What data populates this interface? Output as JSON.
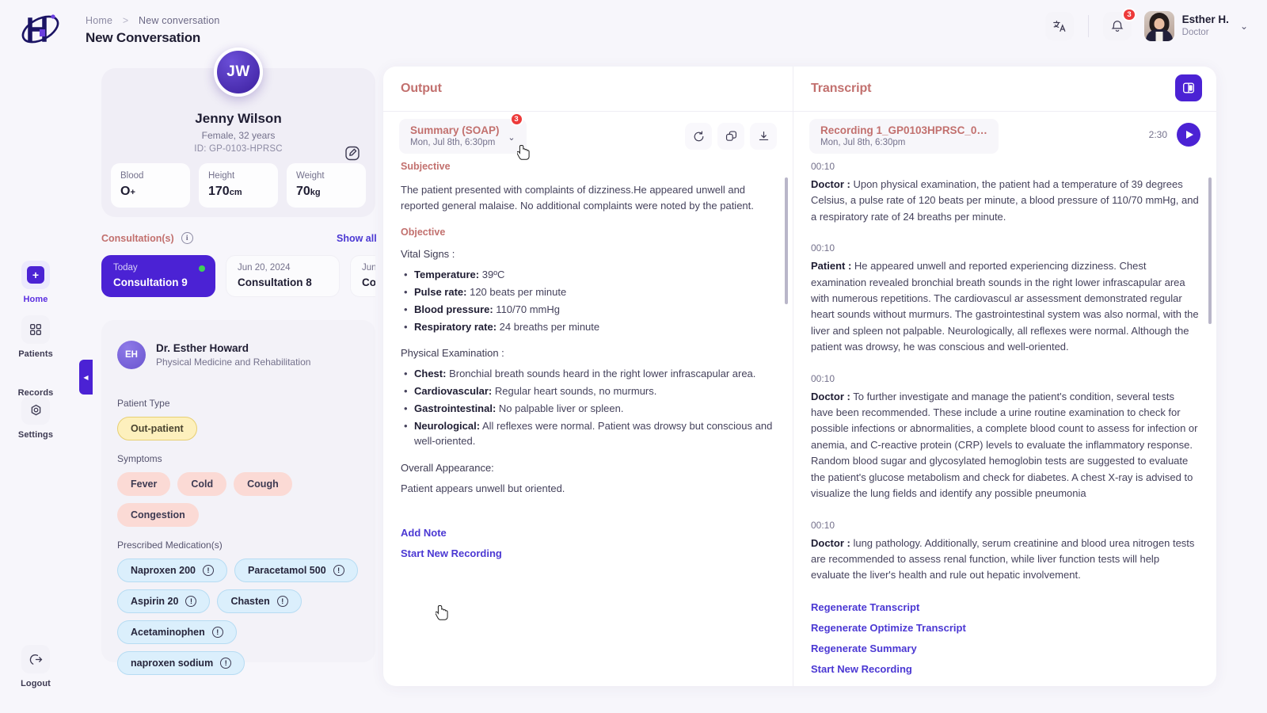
{
  "header": {
    "breadcrumb": {
      "home": "Home",
      "separator": ">",
      "current": "New conversation"
    },
    "page_title": "New Conversation",
    "translate_icon": "translate-icon",
    "notification_icon": "bell-icon",
    "notification_count": "3",
    "user": {
      "name": "Esther H.",
      "role": "Doctor"
    },
    "caret": "⌄"
  },
  "rail": {
    "items": [
      {
        "label": "Home",
        "icon": "home-plus-icon",
        "active": true
      },
      {
        "label": "Patients",
        "icon": "grid-icon",
        "active": false
      },
      {
        "label": "Records",
        "icon": "records-icon",
        "active": false
      },
      {
        "label": "Settings",
        "icon": "gear-hex-icon",
        "active": false
      }
    ],
    "logout": {
      "label": "Logout",
      "icon": "logout-icon"
    },
    "collapse_icon": "chevron-left-icon"
  },
  "patient": {
    "initials": "JW",
    "name": "Jenny Wilson",
    "sub": "Female, 32 years",
    "id": "ID: GP-0103-HPRSC",
    "edit_icon": "edit-pencil-icon",
    "stats": [
      {
        "label": "Blood",
        "value": "O",
        "unit": "+"
      },
      {
        "label": "Height",
        "value": "170",
        "unit": "cm"
      },
      {
        "label": "Weight",
        "value": "70",
        "unit": "kg"
      }
    ]
  },
  "consultations": {
    "title": "Consultation(s)",
    "info_icon": "info-icon",
    "show_all": "Show all",
    "cards": [
      {
        "date": "Today",
        "name": "Consultation 9",
        "selected": true
      },
      {
        "date": "Jun 20, 2024",
        "name": "Consultation 8",
        "selected": false
      },
      {
        "date": "Jun",
        "name": "Con",
        "selected": false
      }
    ]
  },
  "details": {
    "doctor": {
      "initials": "EH",
      "name": "Dr. Esther Howard",
      "specialty": "Physical Medicine and Rehabilitation"
    },
    "patient_type_label": "Patient Type",
    "patient_type": "Out-patient",
    "symptoms_label": "Symptoms",
    "symptoms": [
      "Fever",
      "Cold",
      "Cough",
      "Congestion"
    ],
    "medication_label": "Prescribed Medication(s)",
    "medications": [
      "Naproxen 200",
      "Paracetamol 500",
      "Aspirin 20",
      "Chasten",
      "Acetaminophen",
      "naproxen sodium"
    ],
    "med_warn_icon": "warning-circle-icon"
  },
  "output": {
    "title": "Output",
    "selector": {
      "label": "Summary (SOAP)",
      "timestamp": "Mon, Jul 8th, 6:30pm",
      "badge": "3",
      "caret": "⌄"
    },
    "tools": [
      {
        "name": "regenerate-icon",
        "label": "Regenerate"
      },
      {
        "name": "copy-icon",
        "label": "Copy"
      },
      {
        "name": "download-icon",
        "label": "Download"
      }
    ],
    "subjective_heading": "Subjective",
    "subjective_text": "The patient presented with complaints of dizziness.He appeared unwell and reported general malaise. No additional complaints were noted by the patient.",
    "objective_heading": "Objective",
    "vitals_label": "Vital Signs :",
    "vitals": [
      {
        "k": "Temperature:",
        "v": " 39ºC"
      },
      {
        "k": "Pulse rate:",
        "v": " 120 beats per minute"
      },
      {
        "k": "Blood pressure:",
        "v": " 110/70 mmHg"
      },
      {
        "k": "Respiratory rate:",
        "v": " 24 breaths per minute"
      }
    ],
    "exam_label": "Physical Examination :",
    "exam": [
      {
        "k": "Chest:",
        "v": " Bronchial breath sounds heard in the right lower infrascapular area."
      },
      {
        "k": "Cardiovascular:",
        "v": " Regular heart sounds, no murmurs."
      },
      {
        "k": "Gastrointestinal:",
        "v": " No palpable liver or spleen."
      },
      {
        "k": "Neurological:",
        "v": " All reflexes were normal. Patient was drowsy but conscious and well-oriented."
      }
    ],
    "appearance_label": "Overall Appearance:",
    "appearance_text": "Patient appears unwell but oriented.",
    "links": [
      "Add Note",
      "Start New Recording"
    ]
  },
  "transcript": {
    "title": "Transcript",
    "split_icon": "split-panel-icon",
    "recording": {
      "name": "Recording 1_GP0103HPRSC_0…",
      "timestamp": "Mon, Jul 8th, 6:30pm",
      "duration": "2:30",
      "play_icon": "play-icon"
    },
    "blocks": [
      {
        "time": "00:10",
        "speaker": "Doctor :",
        "text": " Upon physical examination, the patient had a temperature of 39 degrees Celsius, a pulse rate of 120 beats per minute, a blood pressure of 110/70 mmHg, and a respiratory rate of 24 breaths per minute."
      },
      {
        "time": "00:10",
        "speaker": "Patient :",
        "text": " He appeared unwell and reported experiencing dizziness. Chest examination revealed bronchial breath sounds in the right lower infrascapular area with numerous repetitions. The cardiovascul ar assessment demonstrated regular heart sounds without murmurs. The gastrointestinal system was also normal, with the liver and spleen not palpable. Neurologically, all reflexes were normal. Although the patient was drowsy, he was conscious and well-oriented."
      },
      {
        "time": "00:10",
        "speaker": "Doctor :",
        "text": " To further investigate and manage the patient's condition, several tests have been recommended. These include a urine routine examination to check for possible infections or abnormalities, a complete blood count to assess for infection or anemia, and C-reactive protein (CRP) levels to evaluate the inflammatory response. Random blood sugar and glycosylated hemoglobin tests are suggested to evaluate the patient's glucose metabolism and check for diabetes. A chest X-ray is advised to visualize the lung fields and identify any possible pneumonia"
      },
      {
        "time": "00:10",
        "speaker": "Doctor :",
        "text": " lung pathology. Additionally, serum creatinine and blood urea nitrogen tests are recommended to assess renal function, while liver function tests will help evaluate the liver's health and rule out hepatic involvement."
      }
    ],
    "links": [
      "Regenerate Transcript",
      "Regenerate Optimize Transcript",
      "Regenerate Summary",
      "Start New Recording"
    ]
  },
  "colors": {
    "brand": "#4b22d4",
    "accent_link": "#4b38d3",
    "heading": "#c2706e",
    "danger": "#ed3a3a",
    "status_green": "#3fd058"
  }
}
